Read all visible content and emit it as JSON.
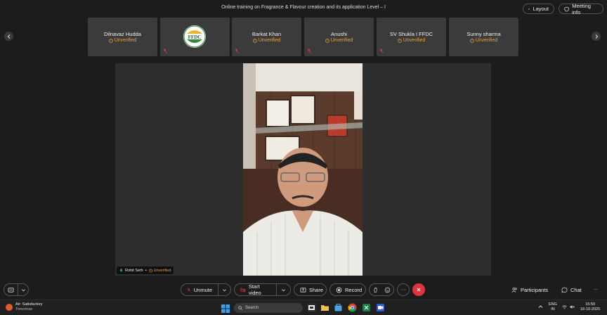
{
  "meeting": {
    "title": "Online training on Fragrance & Flavour creation and its application Level – I",
    "layout_label": "Layout",
    "info_label": "Meeting info"
  },
  "participants": [
    {
      "name": "Dilnavaz Hudda",
      "status": "Unverified"
    },
    {
      "name": "",
      "status": "",
      "logo_text": "FFDC"
    },
    {
      "name": "Barkat Khan",
      "status": "Unverified"
    },
    {
      "name": "Anushi",
      "status": "Unverified"
    },
    {
      "name": "SV Shukla I FFDC",
      "status": "Unverified"
    },
    {
      "name": "Sunny sharma",
      "status": "Unverified"
    }
  ],
  "speaker": {
    "name": "Rohit Seth",
    "separator": "•",
    "status": "Unverified"
  },
  "controls": {
    "unmute": "Unmute",
    "start_video": "Start video",
    "share": "Share",
    "record": "Record",
    "participants": "Participants",
    "chat": "Chat",
    "more": "···"
  },
  "taskbar": {
    "weather_line1": "Air: Satisfactory",
    "weather_line2": "Tomorrow",
    "search_placeholder": "Search",
    "lang_line1": "ENG",
    "lang_line2": "IN",
    "time": "15:59",
    "date": "16-10-2025"
  },
  "colors": {
    "accent_unverified": "#e9a13b",
    "end_call": "#e0333a",
    "muted": "#e0333a"
  }
}
